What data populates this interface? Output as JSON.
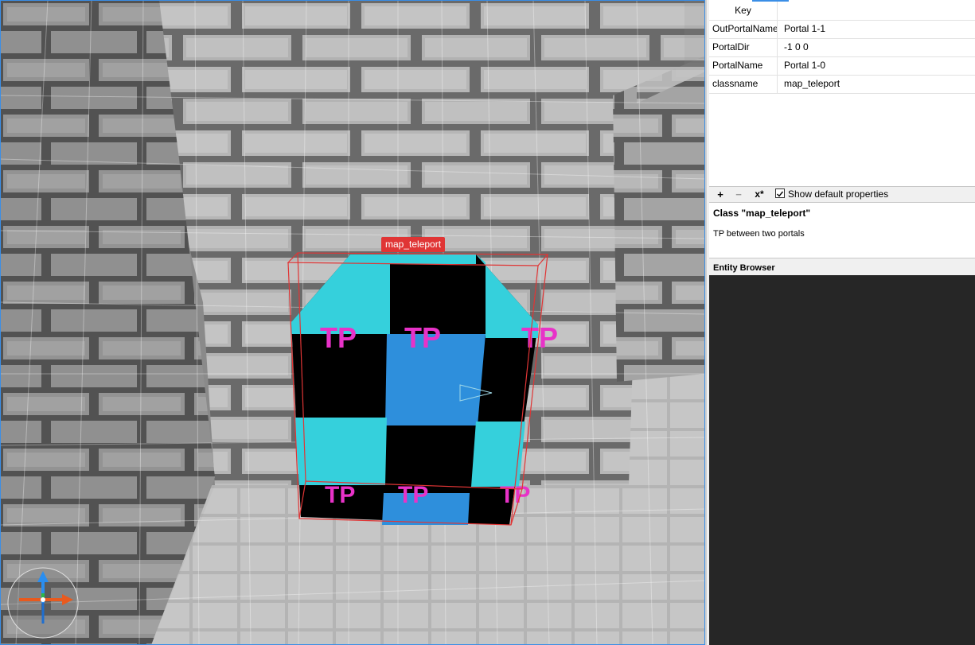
{
  "viewport": {
    "selected_entity_label": "map_teleport",
    "texture_text": "TP"
  },
  "properties": {
    "header": {
      "key": "Key",
      "value": ""
    },
    "rows": [
      {
        "key": "OutPortalName",
        "value": "Portal 1-1"
      },
      {
        "key": "PortalDir",
        "value": "-1 0 0"
      },
      {
        "key": "PortalName",
        "value": "Portal 1-0"
      },
      {
        "key": "classname",
        "value": "map_teleport"
      }
    ]
  },
  "toolbar": {
    "add_icon": "plus-icon",
    "remove_icon": "minus-icon",
    "clear_icon": "clear-x-icon",
    "add_label": "+",
    "remove_label": "−",
    "clear_label": "x*",
    "show_default_checked": true,
    "show_default_label": "Show default properties"
  },
  "class_info": {
    "title": "Class \"map_teleport\"",
    "description": "TP between two portals"
  },
  "entity_browser": {
    "title": "Entity Browser"
  },
  "colors": {
    "accent": "#3a8ee6",
    "selection": "#e03535",
    "cyan": "#35d0dc",
    "blue": "#2e8fdc",
    "magenta": "#e832c8"
  }
}
